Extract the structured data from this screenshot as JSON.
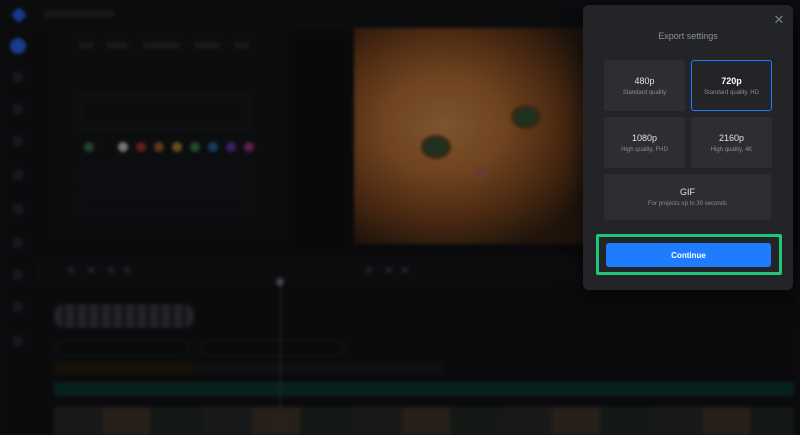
{
  "dialog": {
    "title": "Export settings",
    "close_icon": "close-icon",
    "options": [
      {
        "name": "480p",
        "desc": "Standard quality",
        "selected": false
      },
      {
        "name": "720p",
        "desc": "Standard quality, HD",
        "selected": true
      },
      {
        "name": "1080p",
        "desc": "High quality, FHD",
        "selected": false
      },
      {
        "name": "2160p",
        "desc": "High quality, 4K",
        "selected": false
      },
      {
        "name": "GIF",
        "desc": "For projects up to 30 seconds",
        "selected": false
      }
    ],
    "continue_label": "Continue"
  },
  "colors": {
    "accent": "#1f7cff",
    "highlight": "#1fc77a",
    "dialog_bg": "#232428",
    "option_bg": "#2d2e33"
  }
}
